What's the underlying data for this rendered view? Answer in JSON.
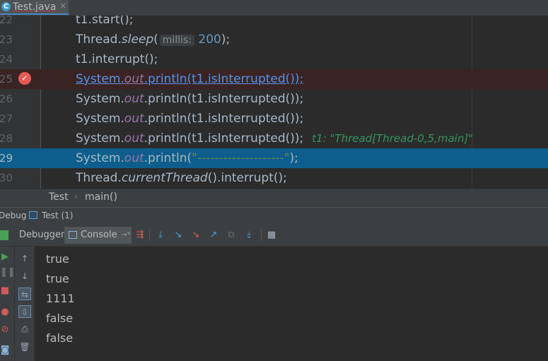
{
  "tab": {
    "label": "Test.java",
    "close": "×",
    "icon": "java-class-icon"
  },
  "editor": {
    "lines": [
      {
        "num": "22",
        "segments": [
          {
            "t": "t1.start();",
            "c": ""
          }
        ]
      },
      {
        "num": "23",
        "segments": [
          {
            "t": "Thread.",
            "c": ""
          },
          {
            "t": "sleep",
            "c": "it"
          },
          {
            "t": "(",
            "c": ""
          },
          {
            "t": "millis:",
            "c": "hint"
          },
          {
            "t": " 200",
            "c": "num"
          },
          {
            "t": ");",
            "c": ""
          }
        ]
      },
      {
        "num": "24",
        "segments": [
          {
            "t": "t1.interrupt();",
            "c": ""
          }
        ]
      },
      {
        "num": "25",
        "segments": [
          {
            "t": "System.",
            "c": "link"
          },
          {
            "t": "out",
            "c": "link purple"
          },
          {
            "t": ".println(t1.isInterrupted());",
            "c": "link"
          }
        ],
        "breakpoint": true
      },
      {
        "num": "26",
        "segments": [
          {
            "t": "System.",
            "c": ""
          },
          {
            "t": "out",
            "c": "purple"
          },
          {
            "t": ".println(t1.isInterrupted());",
            "c": ""
          }
        ]
      },
      {
        "num": "27",
        "segments": [
          {
            "t": "System.",
            "c": ""
          },
          {
            "t": "out",
            "c": "purple"
          },
          {
            "t": ".println(t1.isInterrupted());",
            "c": ""
          }
        ]
      },
      {
        "num": "28",
        "segments": [
          {
            "t": "System.",
            "c": ""
          },
          {
            "t": "out",
            "c": "purple"
          },
          {
            "t": ".println(t1.isInterrupted());",
            "c": ""
          },
          {
            "t": "t1: \"Thread[Thread-0,5,main]\"",
            "c": "inline-val"
          }
        ]
      },
      {
        "num": "29",
        "segments": [
          {
            "t": "System.",
            "c": ""
          },
          {
            "t": "out",
            "c": "purple"
          },
          {
            "t": ".println(",
            "c": ""
          },
          {
            "t": "\"--------------------\"",
            "c": "str"
          },
          {
            "t": ");",
            "c": ""
          }
        ],
        "current": true
      },
      {
        "num": "30",
        "segments": [
          {
            "t": "Thread.",
            "c": ""
          },
          {
            "t": "currentThread",
            "c": "it"
          },
          {
            "t": "().interrupt();",
            "c": ""
          }
        ]
      }
    ]
  },
  "breadcrumb": {
    "items": [
      "Test",
      "main()"
    ],
    "separator": "›"
  },
  "debug": {
    "label": "Debug",
    "session": "Test (1)"
  },
  "toolbar": {
    "debugger_tab": "Debugger",
    "console_tab": "Console",
    "console_pin": "→*",
    "icons": [
      {
        "name": "show-execution-point-icon",
        "glyph": "⇶",
        "color": "#d35a5a"
      },
      {
        "name": "step-over-icon",
        "glyph": "⤓",
        "color": "#4a9fdc"
      },
      {
        "name": "step-into-icon",
        "glyph": "↘",
        "color": "#4a9fdc"
      },
      {
        "name": "force-step-into-icon",
        "glyph": "↘",
        "color": "#e05555"
      },
      {
        "name": "step-out-icon",
        "glyph": "↗",
        "color": "#4a9fdc"
      },
      {
        "name": "drop-frame-icon",
        "glyph": "⧉",
        "color": "#6b6b6b"
      },
      {
        "name": "run-to-cursor-icon",
        "glyph": "⤈",
        "color": "#4a9fdc"
      },
      {
        "name": "evaluate-expression-icon",
        "glyph": "▦",
        "color": "#a9b7c6"
      }
    ]
  },
  "left_tools": [
    {
      "name": "resume-icon",
      "glyph": "▶",
      "color": "#4aa055"
    },
    {
      "name": "pause-icon",
      "glyph": "❚❚",
      "color": "#6b6b6b"
    },
    {
      "name": "stop-icon",
      "glyph": "■",
      "color": "#d35a5a"
    },
    {
      "name": "view-breakpoints-icon",
      "glyph": "●",
      "color": "#d35a5a"
    },
    {
      "name": "mute-breakpoints-icon",
      "glyph": "⊘",
      "color": "#d35a5a"
    },
    {
      "name": "camera-icon",
      "glyph": "◙",
      "color": "#8ab4d8"
    }
  ],
  "console_tools": [
    {
      "name": "up-arrow-icon",
      "glyph": "↑",
      "boxed": false
    },
    {
      "name": "down-arrow-icon",
      "glyph": "↓",
      "boxed": false
    },
    {
      "name": "soft-wrap-icon",
      "glyph": "⇆",
      "boxed": true
    },
    {
      "name": "scroll-to-end-icon",
      "glyph": "⇩",
      "boxed": true
    },
    {
      "name": "print-icon",
      "glyph": "⎙",
      "boxed": false
    },
    {
      "name": "trash-icon",
      "glyph": "🗑",
      "boxed": false
    }
  ],
  "console": {
    "output": [
      "true",
      "true",
      "1111",
      "false",
      "false"
    ]
  }
}
